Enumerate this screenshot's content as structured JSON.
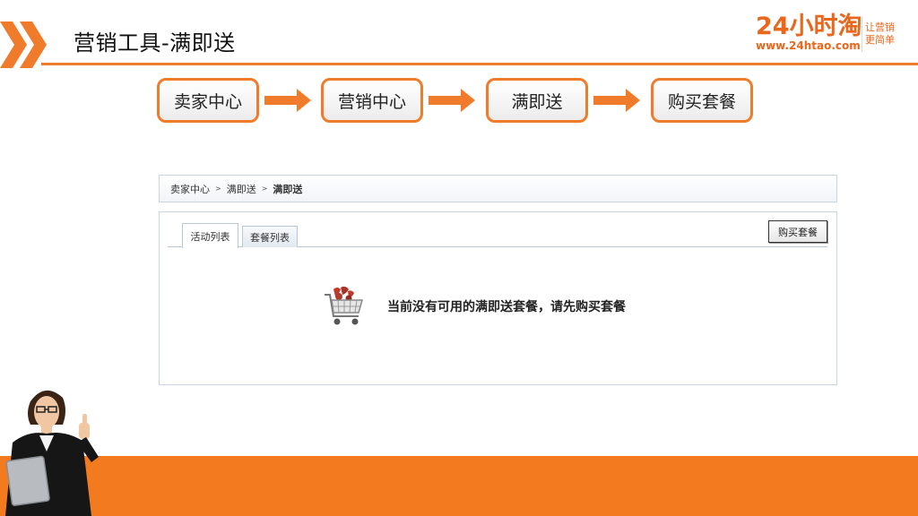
{
  "slide": {
    "title": "营销工具-满即送"
  },
  "logo": {
    "main": "24小时淘",
    "url": "www.24htao.com",
    "slogan_line1": "让营销",
    "slogan_line2": "更简单"
  },
  "flow": {
    "steps": [
      "卖家中心",
      "营销中心",
      "满即送",
      "购买套餐"
    ]
  },
  "breadcrumb": {
    "items": [
      "卖家中心",
      "满即送",
      "满即送"
    ],
    "separator": ">"
  },
  "tabs": [
    {
      "label": "活动列表",
      "active": true
    },
    {
      "label": "套餐列表",
      "active": false
    }
  ],
  "buttons": {
    "buy_package": "购买套餐"
  },
  "empty_state": {
    "icon": "shopping-cart-icon",
    "message": "当前没有可用的满即送套餐，请先购买套餐"
  },
  "colors": {
    "accent": "#f07c2b",
    "band": "#f47a20",
    "border": "#c9d4e0"
  }
}
